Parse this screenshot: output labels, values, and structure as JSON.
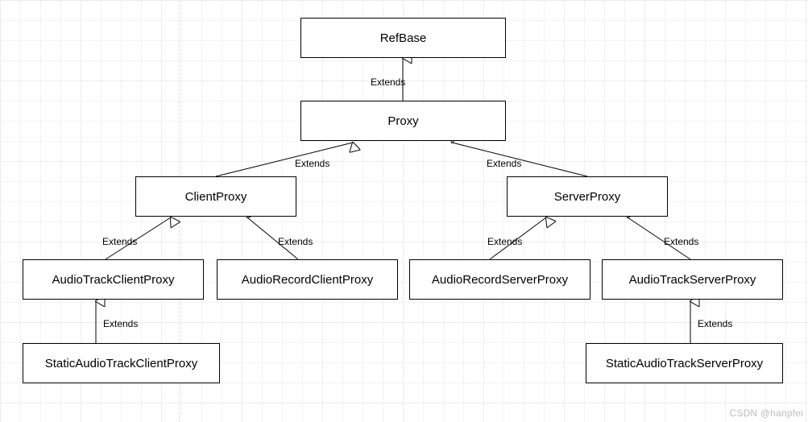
{
  "chart_data": {
    "type": "class-hierarchy",
    "nodes": [
      {
        "id": "RefBase",
        "label": "RefBase"
      },
      {
        "id": "Proxy",
        "label": "Proxy"
      },
      {
        "id": "ClientProxy",
        "label": "ClientProxy"
      },
      {
        "id": "ServerProxy",
        "label": "ServerProxy"
      },
      {
        "id": "AudioTrackClientProxy",
        "label": "AudioTrackClientProxy"
      },
      {
        "id": "AudioRecordClientProxy",
        "label": "AudioRecordClientProxy"
      },
      {
        "id": "AudioRecordServerProxy",
        "label": "AudioRecordServerProxy"
      },
      {
        "id": "AudioTrackServerProxy",
        "label": "AudioTrackServerProxy"
      },
      {
        "id": "StaticAudioTrackClientProxy",
        "label": "StaticAudioTrackClientProxy"
      },
      {
        "id": "StaticAudioTrackServerProxy",
        "label": "StaticAudioTrackServerProxy"
      }
    ],
    "edges": [
      {
        "from": "Proxy",
        "to": "RefBase",
        "label": "Extends"
      },
      {
        "from": "ClientProxy",
        "to": "Proxy",
        "label": "Extends"
      },
      {
        "from": "ServerProxy",
        "to": "Proxy",
        "label": "Extends"
      },
      {
        "from": "AudioTrackClientProxy",
        "to": "ClientProxy",
        "label": "Extends"
      },
      {
        "from": "AudioRecordClientProxy",
        "to": "ClientProxy",
        "label": "Extends"
      },
      {
        "from": "AudioRecordServerProxy",
        "to": "ServerProxy",
        "label": "Extends"
      },
      {
        "from": "AudioTrackServerProxy",
        "to": "ServerProxy",
        "label": "Extends"
      },
      {
        "from": "StaticAudioTrackClientProxy",
        "to": "AudioTrackClientProxy",
        "label": "Extends"
      },
      {
        "from": "StaticAudioTrackServerProxy",
        "to": "AudioTrackServerProxy",
        "label": "Extends"
      }
    ]
  },
  "edge_label": "Extends",
  "watermark": "CSDN @hanpfei"
}
